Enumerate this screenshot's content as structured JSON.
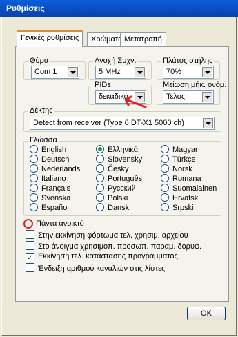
{
  "window": {
    "title": "Ρυθμίσεις"
  },
  "tabs": [
    {
      "label": "Γενικές ρυθμίσεις",
      "active": true
    },
    {
      "label": "Χρώματα",
      "active": false
    },
    {
      "label": "Μετατροπή",
      "active": false
    }
  ],
  "port": {
    "label": "Θύρα",
    "value": "Com 1"
  },
  "freq": {
    "label": "Ανοχή Συχν.",
    "value": "5 MHz"
  },
  "column_width": {
    "label": "Πλάτος στήλης",
    "value": "70%"
  },
  "pids": {
    "label": "PIDs",
    "value": "δεκαδικό"
  },
  "name_reduction": {
    "label": "Μείωση μήκ. ονόμ.",
    "value": "Τέλος"
  },
  "receiver": {
    "label": "Δέκτης",
    "value": "Detect from receiver (Type 6 DT-X1 5000 ch)"
  },
  "language": {
    "label": "Γλώσσα",
    "selected": "Ελληνικά",
    "col1": [
      "English",
      "Deutsch",
      "Nederlands",
      "Italiano",
      "Français",
      "Svenska",
      "Español"
    ],
    "col2": [
      "Ελληνικά",
      "Slovensky",
      "Česky",
      "Português",
      "Русский",
      "Polski",
      "Dansk"
    ],
    "col3": [
      "Magyar",
      "Türkçe",
      "Norsk",
      "Romana",
      "Suomalainen",
      "Hrvatski",
      "Srpski"
    ]
  },
  "options": {
    "always_open": "Πάντα ανοικτό",
    "checks": [
      {
        "label": "Στην εκκίνηση φόρτωμα τελ. χρησιμ. αρχείου",
        "checked": false
      },
      {
        "label": "Στο άνοιγμα χρησιμοπ. προσωπ. παραμ. δορυφ.",
        "checked": false
      },
      {
        "label": "Εκκίνηση τελ. κατάστασης προγράμματος",
        "checked": true
      },
      {
        "label": "Ένδειξη αριθμού καναλιών στις λίστες",
        "checked": false
      }
    ]
  },
  "ok_label": "OK",
  "colors": {
    "title_bar": "#0a5fd8",
    "annotation": "#e51e1e"
  }
}
